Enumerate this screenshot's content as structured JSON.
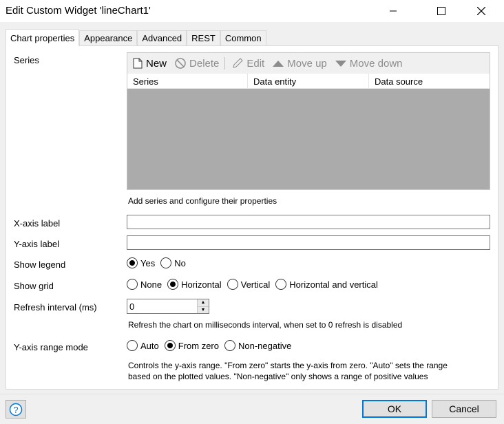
{
  "window": {
    "title": "Edit Custom Widget 'lineChart1'",
    "minimize_icon": "minimize-icon",
    "maximize_icon": "maximize-icon",
    "close_icon": "close-icon"
  },
  "tabs": [
    {
      "label": "Chart properties",
      "active": true
    },
    {
      "label": "Appearance",
      "active": false
    },
    {
      "label": "Advanced",
      "active": false
    },
    {
      "label": "REST",
      "active": false
    },
    {
      "label": "Common",
      "active": false
    }
  ],
  "series": {
    "label": "Series",
    "toolbar": {
      "new_label": "New",
      "delete_label": "Delete",
      "edit_label": "Edit",
      "move_up_label": "Move up",
      "move_down_label": "Move down"
    },
    "columns": [
      "Series",
      "Data entity",
      "Data source"
    ],
    "hint": "Add series and configure their properties"
  },
  "x_axis": {
    "label": "X-axis label",
    "value": ""
  },
  "y_axis": {
    "label": "Y-axis label",
    "value": ""
  },
  "show_legend": {
    "label": "Show legend",
    "options": [
      "Yes",
      "No"
    ],
    "selected": "Yes"
  },
  "show_grid": {
    "label": "Show grid",
    "options": [
      "None",
      "Horizontal",
      "Vertical",
      "Horizontal and vertical"
    ],
    "selected": "Horizontal"
  },
  "refresh": {
    "label": "Refresh interval (ms)",
    "value": "0",
    "hint": "Refresh the chart on milliseconds interval, when set to 0 refresh is disabled"
  },
  "y_range": {
    "label": "Y-axis range mode",
    "options": [
      "Auto",
      "From zero",
      "Non-negative"
    ],
    "selected": "From zero",
    "hint_line1": "Controls the y-axis range. \"From zero\" starts the y-axis from zero. \"Auto\" sets the range",
    "hint_line2": "based on the plotted values. \"Non-negative\" only shows a range of positive values"
  },
  "footer": {
    "ok_label": "OK",
    "cancel_label": "Cancel",
    "help_icon": "question-mark-icon"
  },
  "colors": {
    "accent": "#0078d7",
    "grid_bg": "#ababab"
  }
}
